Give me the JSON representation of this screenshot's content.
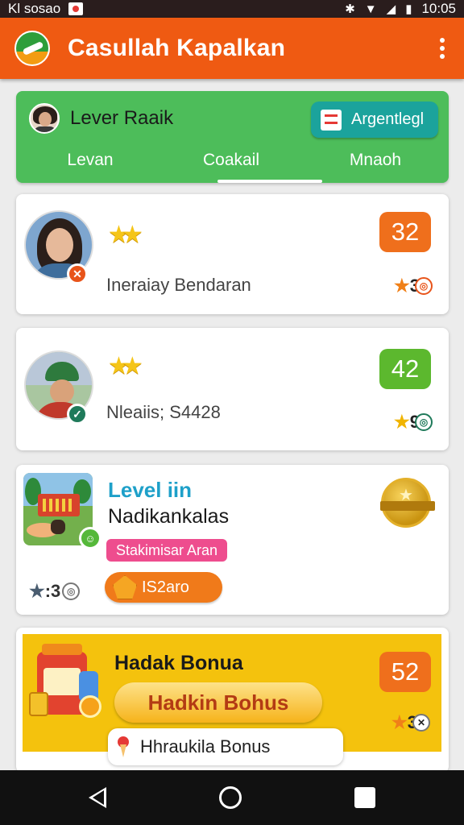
{
  "status_bar": {
    "carrier": "Kl sosao",
    "time": "10:05"
  },
  "app_bar": {
    "title": "Casullah Kapalkan"
  },
  "profile": {
    "name": "Lever Raaik",
    "action_label": "Argentlegl"
  },
  "tabs": [
    {
      "label": "Levan"
    },
    {
      "label": "Coakail"
    },
    {
      "label": "Mnaoh"
    }
  ],
  "active_tab": "Coakail",
  "cards": [
    {
      "stars": 2,
      "subtitle": "Ineraiay Bendaran",
      "score": "32",
      "score_color": "#ef6f1c",
      "stat": "3"
    },
    {
      "stars": 2,
      "subtitle": "Nleaiis; S4428",
      "score": "42",
      "score_color": "#5cb82e",
      "stat": "9"
    }
  ],
  "level_card": {
    "title": "Level iin",
    "subtitle": "Nadikankalas",
    "tag": "Stakimisar Aran",
    "stat": ":3",
    "button_label": "IS2aro"
  },
  "bonus_card": {
    "title": "Hadak Bonua",
    "button_label": "Hadkin Bohus",
    "score": "52",
    "stat": "3",
    "pill_label": "Hhraukila Bonus"
  },
  "colors": {
    "app_bar": "#ef5a12",
    "profile_card": "#4dbd5a",
    "agent_button": "#1ba39c",
    "bonus_panel": "#f4c20d"
  }
}
